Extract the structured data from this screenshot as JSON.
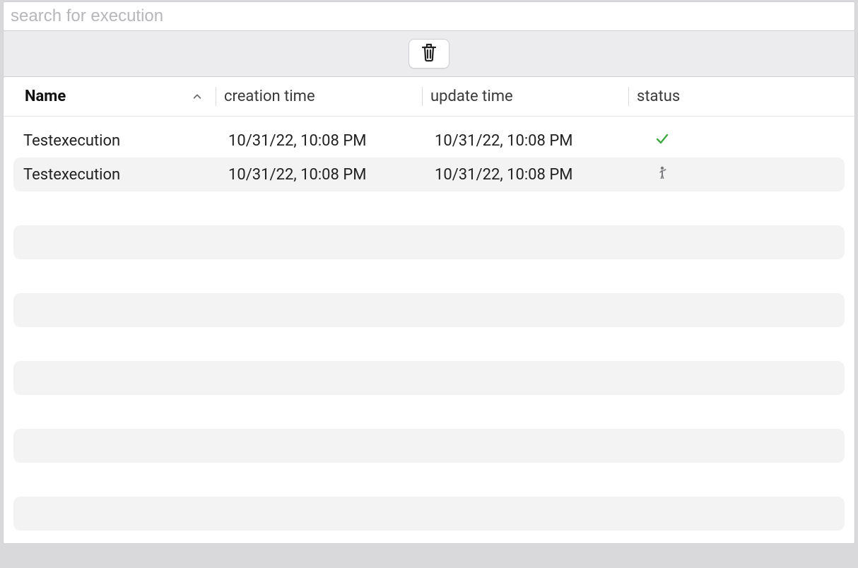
{
  "search": {
    "placeholder": "search for execution",
    "value": ""
  },
  "toolbar": {
    "delete_title": "Delete"
  },
  "table": {
    "columns": {
      "name": "Name",
      "creation_time": "creation time",
      "update_time": "update time",
      "status": "status"
    },
    "sort": {
      "column": "name",
      "direction": "asc"
    },
    "rows": [
      {
        "name": "Testexecution",
        "creation_time": "10/31/22, 10:08 PM",
        "update_time": "10/31/22, 10:08 PM",
        "status_icon": "check"
      },
      {
        "name": "Testexecution",
        "creation_time": "10/31/22, 10:08 PM",
        "update_time": "10/31/22, 10:08 PM",
        "status_icon": "person"
      }
    ],
    "placeholder_rows": 5
  }
}
